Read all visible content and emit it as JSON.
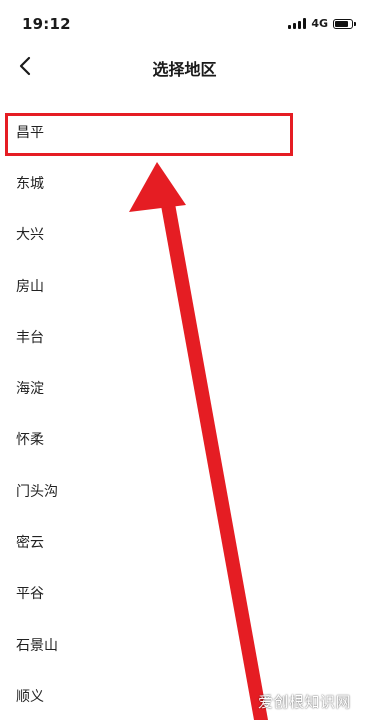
{
  "status_bar": {
    "time": "19:12",
    "network": "4G",
    "icons": [
      "signal-icon",
      "battery-icon"
    ]
  },
  "nav": {
    "back_icon": "chevron-left-icon",
    "title": "选择地区"
  },
  "regions": [
    {
      "label": "昌平",
      "highlighted": true
    },
    {
      "label": "东城"
    },
    {
      "label": "大兴"
    },
    {
      "label": "房山"
    },
    {
      "label": "丰台"
    },
    {
      "label": "海淀"
    },
    {
      "label": "怀柔"
    },
    {
      "label": "门头沟"
    },
    {
      "label": "密云"
    },
    {
      "label": "平谷"
    },
    {
      "label": "石景山"
    },
    {
      "label": "顺义"
    }
  ],
  "annotation": {
    "color": "#e51d23",
    "type": "arrow pointing to first item"
  },
  "watermark": "爱创根知识网"
}
